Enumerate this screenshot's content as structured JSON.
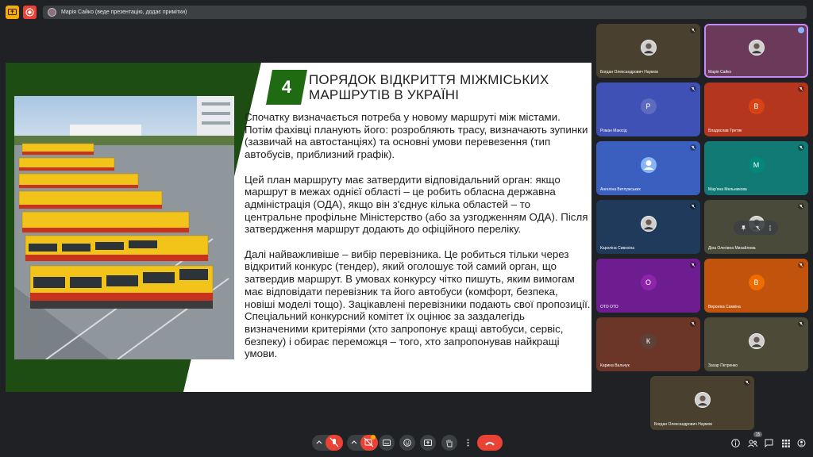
{
  "banner": {
    "presenter_text": "Марія Сайко (веде презентацію, додає примітки)"
  },
  "slide": {
    "number": "4",
    "title": "ПОРЯДОК ВІДКРИТТЯ МІЖМІСЬКИХ МАРШРУТІВ В УКРАЇНІ",
    "paragraphs": [
      "Спочатку визначається потреба у новому маршруті між містами. Потім фахівці планують його: розробляють трасу, визначають зупинки (зазвичай на автостанціях) та основні умови перевезення (тип автобусів, приблизний графік).",
      "Цей план маршруту має затвердити відповідальний орган: якщо маршрут в межах однієї області – це робить обласна державна адміністрація (ОДА), якщо він з'єднує кілька областей – то центральне профільне Міністерство (або за узгодженням ОДА). Після затвердження маршрут додають до офіційного переліку.",
      "Далі найважливіше – вибір перевізника. Це робиться тільки через відкритий конкурс (тендер), який оголошує той самий орган, що затвердив маршрут. В умовах конкурсу чітко пишуть, яким вимогам має відповідати перевізник та його автобуси (комфорт, безпека, новіші моделі тощо). Зацікавлені перевізники подають свої пропозиції. Спеціальний конкурсний комітет їх оцінює за заздалегідь визначеними критеріями (хто запропонує кращі автобуси, сервіс, безпеку) і обирає переможця – того, хто запропонував найкращі умови."
    ]
  },
  "participants": [
    {
      "name": "Богдан Олександрович Наумов",
      "initial": "",
      "color": "#4a4030",
      "photo": true
    },
    {
      "name": "Марія Сайко",
      "initial": "",
      "color": "#6b3a5a",
      "photo": true,
      "active": true
    },
    {
      "name": "Роман Маюсід",
      "initial": "Р",
      "color": "#3f51b5",
      "avatar_color": "#5c6bc0"
    },
    {
      "name": "Владислав Третяк",
      "initial": "В",
      "color": "#b5361f",
      "avatar_color": "#d84315"
    },
    {
      "name": "Ангеліна Ветлужських",
      "initial": "",
      "color": "#3b5fbf",
      "avatar_color": "#8ab4f8",
      "generic": true
    },
    {
      "name": "Мар'яна Мельникова",
      "initial": "М",
      "color": "#127a74",
      "avatar_color": "#00897b"
    },
    {
      "name": "Кароліна Сивохіна",
      "initial": "",
      "color": "#1f3a5a",
      "photo": true
    },
    {
      "name": "Діна Олегівна Михайлова",
      "initial": "",
      "color": "#4a4a3a",
      "photo": true,
      "hover": true
    },
    {
      "name": "ОТО ОТО",
      "initial": "О",
      "color": "#6d1d8f",
      "avatar_color": "#8e24aa"
    },
    {
      "name": "Вероніка Самкіна",
      "initial": "В",
      "color": "#c2530d",
      "avatar_color": "#ef6c00"
    },
    {
      "name": "Карина Вальчук",
      "initial": "К",
      "color": "#6b3528",
      "avatar_color": "#5d4037"
    },
    {
      "name": "Захар Петренко",
      "initial": "",
      "color": "#4d4a38",
      "photo": true
    },
    {
      "name": "Богдан Олександрович Наумов",
      "initial": "",
      "color": "#4a4030",
      "photo": true
    }
  ],
  "bottom_bar": {
    "participant_count": "15"
  }
}
